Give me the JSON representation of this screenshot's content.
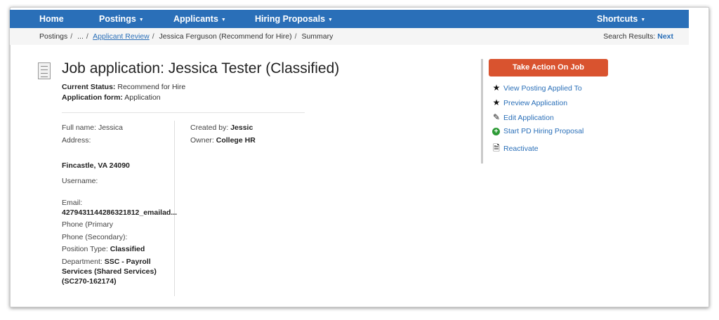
{
  "nav": {
    "home": "Home",
    "postings": "Postings",
    "applicants": "Applicants",
    "hiring_proposals": "Hiring Proposals",
    "shortcuts": "Shortcuts"
  },
  "breadcrumb": {
    "postings": "Postings",
    "ellipsis": "...",
    "applicant_review": "Applicant Review",
    "applicant": "Jessica Ferguson (Recommend for Hire)",
    "summary": "Summary",
    "search_results_label": "Search Results:",
    "next": "Next"
  },
  "page": {
    "title": "Job application: Jessica Tester (Classified)",
    "status_label": "Current Status:",
    "status_value": "Recommend for Hire",
    "form_label": "Application form:",
    "form_value": "Application"
  },
  "details": {
    "full_name_label": "Full name:",
    "full_name_value": "Jessica",
    "address_label": "Address:",
    "address_city": "Fincastle, VA 24090",
    "username_label": "Username:",
    "email_label": "Email:",
    "email_value": "4279431144286321812_emailad...",
    "phone_primary_label": "Phone (Primary",
    "phone_secondary_label": "Phone (Secondary):",
    "position_type_label": "Position Type:",
    "position_type_value": "Classified",
    "department_label": "Department:",
    "department_value": "SSC - Payroll Services (Shared Services) (SC270-162174)",
    "created_by_label": "Created by:",
    "created_by_value": "Jessic",
    "owner_label": "Owner:",
    "owner_value": "College HR"
  },
  "actions": {
    "take_action": "Take Action On Job Application",
    "view_posting": "View Posting Applied To",
    "preview": "Preview Application",
    "edit": "Edit Application",
    "start_pd": "Start PD Hiring Proposal",
    "reactivate": "Reactivate"
  },
  "colors": {
    "nav_blue": "#2a6fb8",
    "action_orange": "#d9532f",
    "plus_green": "#2e9b36"
  }
}
